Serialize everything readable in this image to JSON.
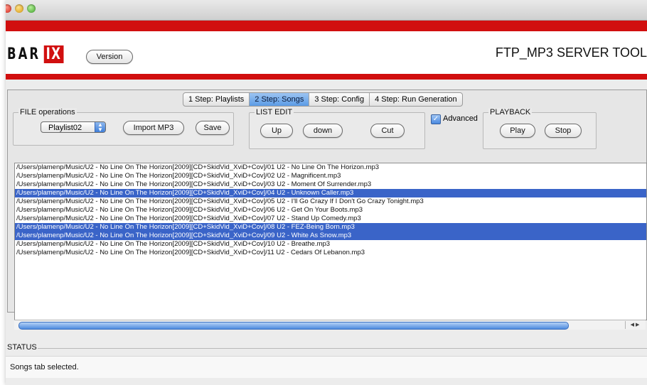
{
  "header": {
    "logo_left": "BAR",
    "logo_right": "IX",
    "version_label": "Version",
    "app_title": "FTP_MP3 SERVER TOOL"
  },
  "tabs": [
    {
      "label": "1 Step: Playlists",
      "active": false
    },
    {
      "label": "2 Step: Songs",
      "active": true
    },
    {
      "label": "3 Step: Config",
      "active": false
    },
    {
      "label": "4 Step: Run Generation",
      "active": false
    }
  ],
  "file_ops": {
    "title": "FILE operations",
    "playlist_selected": "Playlist02",
    "import_label": "Import MP3",
    "save_label": "Save"
  },
  "list_edit": {
    "title": "LIST EDIT",
    "up_label": "Up",
    "down_label": "down",
    "cut_label": "Cut"
  },
  "advanced": {
    "label": "Advanced",
    "checked": true
  },
  "playback": {
    "title": "PLAYBACK",
    "play_label": "Play",
    "stop_label": "Stop"
  },
  "songs": [
    {
      "path": "/Users/plamenp/Music/U2 - No Line On The Horizon[2009][CD+SkidVid_XviD+Cov]/01  U2 - No Line On The Horizon.mp3",
      "selected": false
    },
    {
      "path": "/Users/plamenp/Music/U2 - No Line On The Horizon[2009][CD+SkidVid_XviD+Cov]/02  U2 - Magnificent.mp3",
      "selected": false
    },
    {
      "path": "/Users/plamenp/Music/U2 - No Line On The Horizon[2009][CD+SkidVid_XviD+Cov]/03  U2 - Moment Of Surrender.mp3",
      "selected": false
    },
    {
      "path": "/Users/plamenp/Music/U2 - No Line On The Horizon[2009][CD+SkidVid_XviD+Cov]/04  U2 - Unknown Caller.mp3",
      "selected": true
    },
    {
      "path": "/Users/plamenp/Music/U2 - No Line On The Horizon[2009][CD+SkidVid_XviD+Cov]/05  U2 - I'll Go Crazy If I Don't Go Crazy Tonight.mp3",
      "selected": false
    },
    {
      "path": "/Users/plamenp/Music/U2 - No Line On The Horizon[2009][CD+SkidVid_XviD+Cov]/06  U2 - Get On Your Boots.mp3",
      "selected": false
    },
    {
      "path": "/Users/plamenp/Music/U2 - No Line On The Horizon[2009][CD+SkidVid_XviD+Cov]/07  U2 - Stand Up Comedy.mp3",
      "selected": false
    },
    {
      "path": "/Users/plamenp/Music/U2 - No Line On The Horizon[2009][CD+SkidVid_XviD+Cov]/08  U2 - FEZ-Being Born.mp3",
      "selected": true
    },
    {
      "path": "/Users/plamenp/Music/U2 - No Line On The Horizon[2009][CD+SkidVid_XviD+Cov]/09  U2 - White As Snow.mp3",
      "selected": true
    },
    {
      "path": "/Users/plamenp/Music/U2 - No Line On The Horizon[2009][CD+SkidVid_XviD+Cov]/10  U2 - Breathe.mp3",
      "selected": false
    },
    {
      "path": "/Users/plamenp/Music/U2 - No Line On The Horizon[2009][CD+SkidVid_XviD+Cov]/11  U2 - Cedars Of Lebanon.mp3",
      "selected": false
    }
  ],
  "status": {
    "title": "STATUS",
    "message": "Songs tab selected."
  },
  "colors": {
    "brand_red": "#d10f0f",
    "selection_blue": "#3a64c8",
    "active_tab": "#5b9be5"
  },
  "icons": {
    "close": "close-traffic-light-icon",
    "minimize": "minimize-traffic-light-icon",
    "maximize": "maximize-traffic-light-icon",
    "select": "select-stepper-icon",
    "checkbox": "checkmark-icon"
  }
}
